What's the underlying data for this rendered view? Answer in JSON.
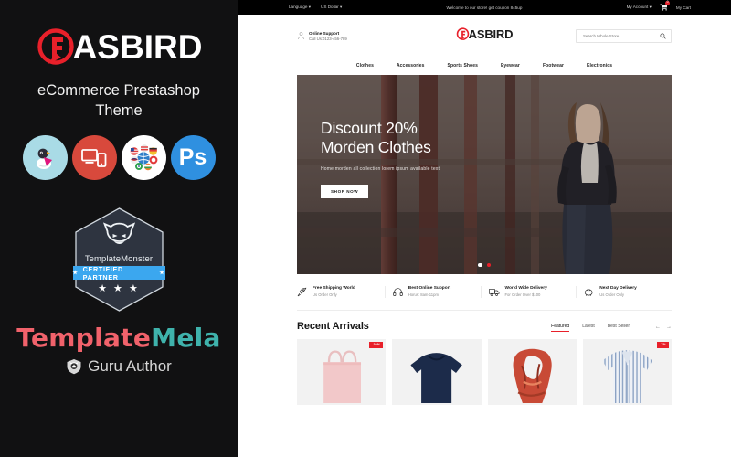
{
  "promo": {
    "logo_word": "ASBIRD",
    "logo_mark": "f-circle-icon",
    "subtitle": "eCommerce Prestashop Theme",
    "feature_icons": [
      {
        "name": "prestashop-icon",
        "color": "#a9dbe6"
      },
      {
        "name": "responsive-devices-icon",
        "color": "#d8493c"
      },
      {
        "name": "multi-language-flags-icon",
        "color": "#ffffff"
      },
      {
        "name": "photoshop-icon",
        "color": "#2f90e0",
        "label": "Ps"
      }
    ],
    "badge": {
      "brand": "TemplateMonster",
      "ribbon": "CERTIFIED PARTNER",
      "stars": "★ ★ ★"
    },
    "brand_a": "Template",
    "brand_b": "Mela",
    "author": "Guru Author"
  },
  "site": {
    "topbar": {
      "language": "Language",
      "currency": "US Dollar",
      "message": "Welcome to our store! get coupon 845up",
      "account": "My Account",
      "cart": "My Cart",
      "cart_count": "0"
    },
    "header": {
      "support_title": "Online Support",
      "support_phone": "Call Us:0123-456-789",
      "logo_word": "ASBIRD",
      "search_placeholder": "Search Whole Store...",
      "search_value": ""
    },
    "nav": [
      "Clothes",
      "Accessories",
      "Sports Shoes",
      "Eyewear",
      "Footwear",
      "Electronics"
    ],
    "hero": {
      "title_line1": "Discount 20%",
      "title_line2": "Morden Clothes",
      "subtitle": "Home morden all collection lorem ipsum available text",
      "cta": "SHOP NOW",
      "slides": 2,
      "active_slide": 2
    },
    "services": [
      {
        "icon": "rocket-icon",
        "title": "Free Shipping World",
        "sub": "Us Order Only"
      },
      {
        "icon": "headset-icon",
        "title": "Best Online Support",
        "sub": "Horus: 8am-11pm"
      },
      {
        "icon": "truck-icon",
        "title": "World Wide Delivery",
        "sub": "For Order Over $100"
      },
      {
        "icon": "piggy-bank-icon",
        "title": "Next Day Delivery",
        "sub": "Us Order Only"
      }
    ],
    "recent": {
      "title": "Recent Arrivals",
      "tabs": [
        {
          "label": "Featured",
          "active": true
        },
        {
          "label": "Latest",
          "active": false
        },
        {
          "label": "Best Seller",
          "active": false
        }
      ],
      "prev": "←",
      "next": "→",
      "products": [
        {
          "name": "pink-tote-bag",
          "discount": "-20%"
        },
        {
          "name": "navy-sweater",
          "discount": ""
        },
        {
          "name": "floral-scarf",
          "discount": ""
        },
        {
          "name": "striped-shirt",
          "discount": "-7%"
        }
      ]
    }
  },
  "colors": {
    "accent_red": "#e8202a",
    "panel_bg": "#111112",
    "ribbon_blue": "#3ba7ef",
    "brand_pink": "#f1626b",
    "brand_teal": "#3fb3ac"
  }
}
